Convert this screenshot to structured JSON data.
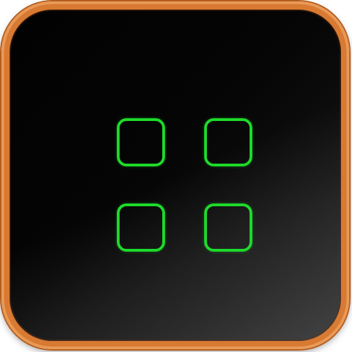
{
  "icon": {
    "name": "app-grid-icon",
    "colors": {
      "frame": "#d87a32",
      "background": "#050505",
      "glyph": "#1ddb2a"
    },
    "tiles": [
      {
        "name": "grid-tile-top-left-icon"
      },
      {
        "name": "grid-tile-top-right-icon"
      },
      {
        "name": "grid-tile-bottom-left-icon"
      },
      {
        "name": "grid-tile-bottom-right-icon"
      }
    ]
  }
}
